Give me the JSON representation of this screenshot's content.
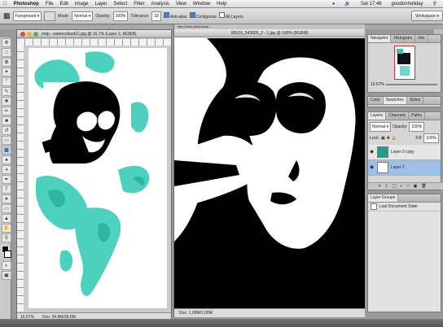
{
  "menubar": {
    "items": [
      "Photoshop",
      "File",
      "Edit",
      "Image",
      "Layer",
      "Select",
      "Filter",
      "Analysis",
      "View",
      "Window",
      "Help"
    ],
    "clock": "Sat 17:46",
    "user": "goodonholiday"
  },
  "options": {
    "mode_preset": "Foreground",
    "mode_label": "Mode:",
    "mode_value": "Normal",
    "opacity_label": "Opacity:",
    "opacity_value": "100%",
    "tolerance_label": "Tolerance:",
    "tolerance_value": "32",
    "antialias_label": "Anti-alias",
    "contiguous_label": "Contiguous",
    "all_layers_label": "All Layers",
    "workspace_label": "Workspace"
  },
  "doc1": {
    "title": "mdp - watercolourEC.jpg @ 16.7% (Layer 2, RGB/8)",
    "zoom": "16.67%",
    "status": "Doc: 34.8M/38.6M"
  },
  "doc2": {
    "title": "8/5/10_343935_2 - 1.jpg @ 100% (RGB/8)",
    "tab_label": "http://www.photoshop...",
    "status": "Doc: 1.00M/1.00M"
  },
  "navigator": {
    "tabs": [
      "Navigator",
      "Histogram",
      "Info"
    ],
    "zoom": "16.67%"
  },
  "color_panel": {
    "tabs": [
      "Color",
      "Swatches",
      "Styles"
    ]
  },
  "layers_panel": {
    "tabs": [
      "Layers",
      "Channels",
      "Paths"
    ],
    "blend_mode": "Normal",
    "opacity_label": "Opacity:",
    "opacity_value": "100%",
    "lock_label": "Lock:",
    "fill_label": "Fill:",
    "fill_value": "100%",
    "layers": [
      {
        "name": "Layer 0 copy",
        "selected": false
      },
      {
        "name": "Layer 2",
        "selected": true
      }
    ]
  },
  "history_panel": {
    "tabs": [
      "Layer Groups"
    ],
    "entry": "Last Document State"
  },
  "colors": {
    "accent": "#3a7bd5",
    "watercolour": "#2fc9b4"
  }
}
